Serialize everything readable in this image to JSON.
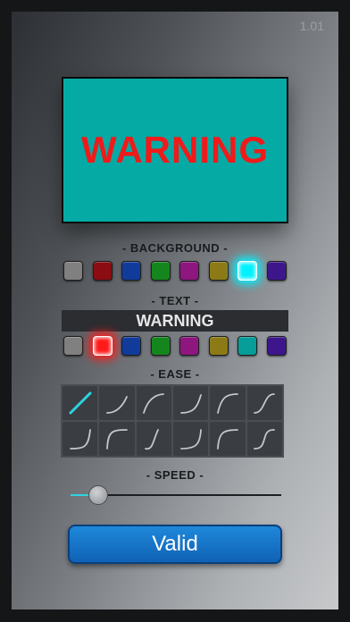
{
  "version": "1.01",
  "preview": {
    "text": "WARNING",
    "background_color": "#05aaa5",
    "text_color": "#ef1a1a"
  },
  "background": {
    "label": "- BACKGROUND -",
    "swatches": [
      "#808080",
      "#8b0c12",
      "#113b9b",
      "#15861e",
      "#8e167f",
      "#8c7a17",
      "#00f2ff",
      "#3d168c"
    ],
    "selected_index": 6
  },
  "text": {
    "label": "- TEXT -",
    "value": "WARNING",
    "swatches": [
      "#808080",
      "#ff1a1a",
      "#113b9b",
      "#15861e",
      "#8e167f",
      "#8c7a17",
      "#079d98",
      "#3d168c"
    ],
    "selected_index": 1
  },
  "ease": {
    "label": "- EASE -",
    "options": [
      "linear",
      "ease-in-quad",
      "ease-out-quad",
      "ease-in-cubic",
      "ease-out-cubic",
      "ease-in-out",
      "ease-in-expo",
      "ease-out-expo",
      "ease-in-back",
      "ease-in-circ",
      "ease-out-circ",
      "ease-in-out-cubic"
    ],
    "selected_index": 0,
    "icon_color": "#c4c6c8",
    "selected_color": "#2cd5e0"
  },
  "speed": {
    "label": "- SPEED -",
    "value": 0.13
  },
  "valid_button": {
    "label": "Valid"
  }
}
